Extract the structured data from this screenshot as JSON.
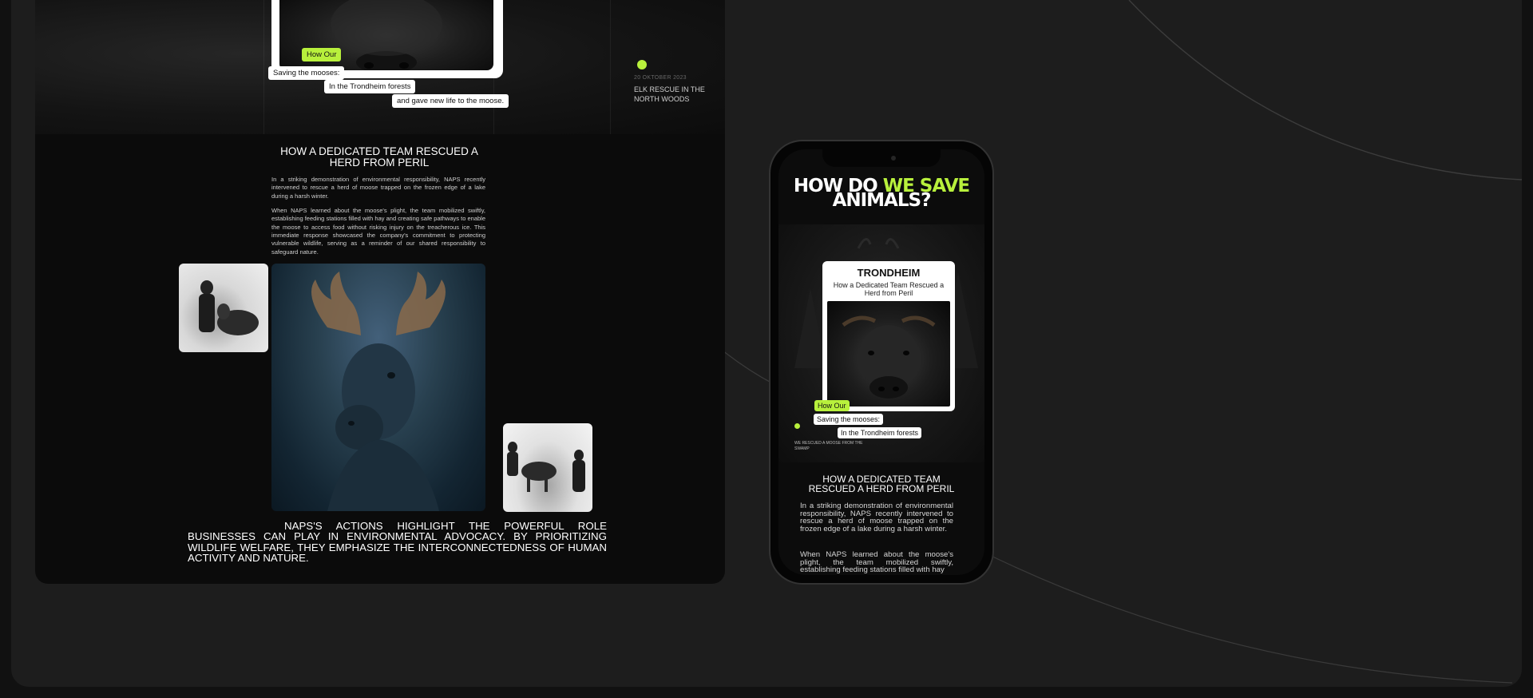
{
  "desktop": {
    "hero": {
      "tags": {
        "how_our": "How Our",
        "saving": "Saving the mooses:",
        "forests": "In the Trondheim forests",
        "new_life": "and gave new life to the moose."
      },
      "date": "20 OKTOBER 2023",
      "caption": "ELK RESCUE IN THE NORTH WOODS"
    },
    "article": {
      "title": "HOW A DEDICATED TEAM RESCUED A HERD FROM PERIL",
      "paragraph_1": "In a striking demonstration of environmental responsibility, NAPS recently intervened to rescue a herd of moose trapped on the frozen edge of a lake during a harsh winter.",
      "paragraph_2": "When NAPS learned about the moose's plight, the team mobilized swiftly, establishing feeding stations filled with hay and creating safe pathways to enable the moose to access food without risking injury on the treacherous ice. This immediate response showcased the company's commitment to protecting vulnerable wildlife, serving as a reminder of our shared responsibility to safeguard nature.",
      "quote": "NAPS'S ACTIONS HIGHLIGHT THE POWERFUL ROLE BUSINESSES CAN PLAY IN ENVIRONMENTAL ADVOCACY. BY PRIORITIZING WILDLIFE WELFARE, THEY EMPHASIZE THE INTERCONNECTEDNESS OF HUMAN ACTIVITY AND NATURE."
    }
  },
  "mobile": {
    "headline_part1": "HOW DO ",
    "headline_highlight": "WE SAVE",
    "headline_part2": "ANIMALS?",
    "card": {
      "title": "TRONDHEIM",
      "subtitle": "How a Dedicated Team Rescued a Herd from Peril"
    },
    "tags": {
      "how_our": "How Our",
      "saving": "Saving the mooses:",
      "forests": "In the Trondheim forests"
    },
    "caption": "WE RESCUED A MOOSE FROM THE SWAMP",
    "article_title": "HOW A DEDICATED TEAM RESCUED A HERD FROM PERIL",
    "paragraph_1": "In a striking demonstration of environmental responsibility, NAPS recently intervened to rescue a herd of moose trapped on the frozen edge of a lake during a harsh winter.",
    "paragraph_2": "When NAPS learned about the moose's plight, the team mobilized swiftly, establishing feeding stations filled with hay"
  },
  "colors": {
    "accent": "#b8f03c",
    "background": "#1d1d1d",
    "panel": "#0b0b0b"
  }
}
